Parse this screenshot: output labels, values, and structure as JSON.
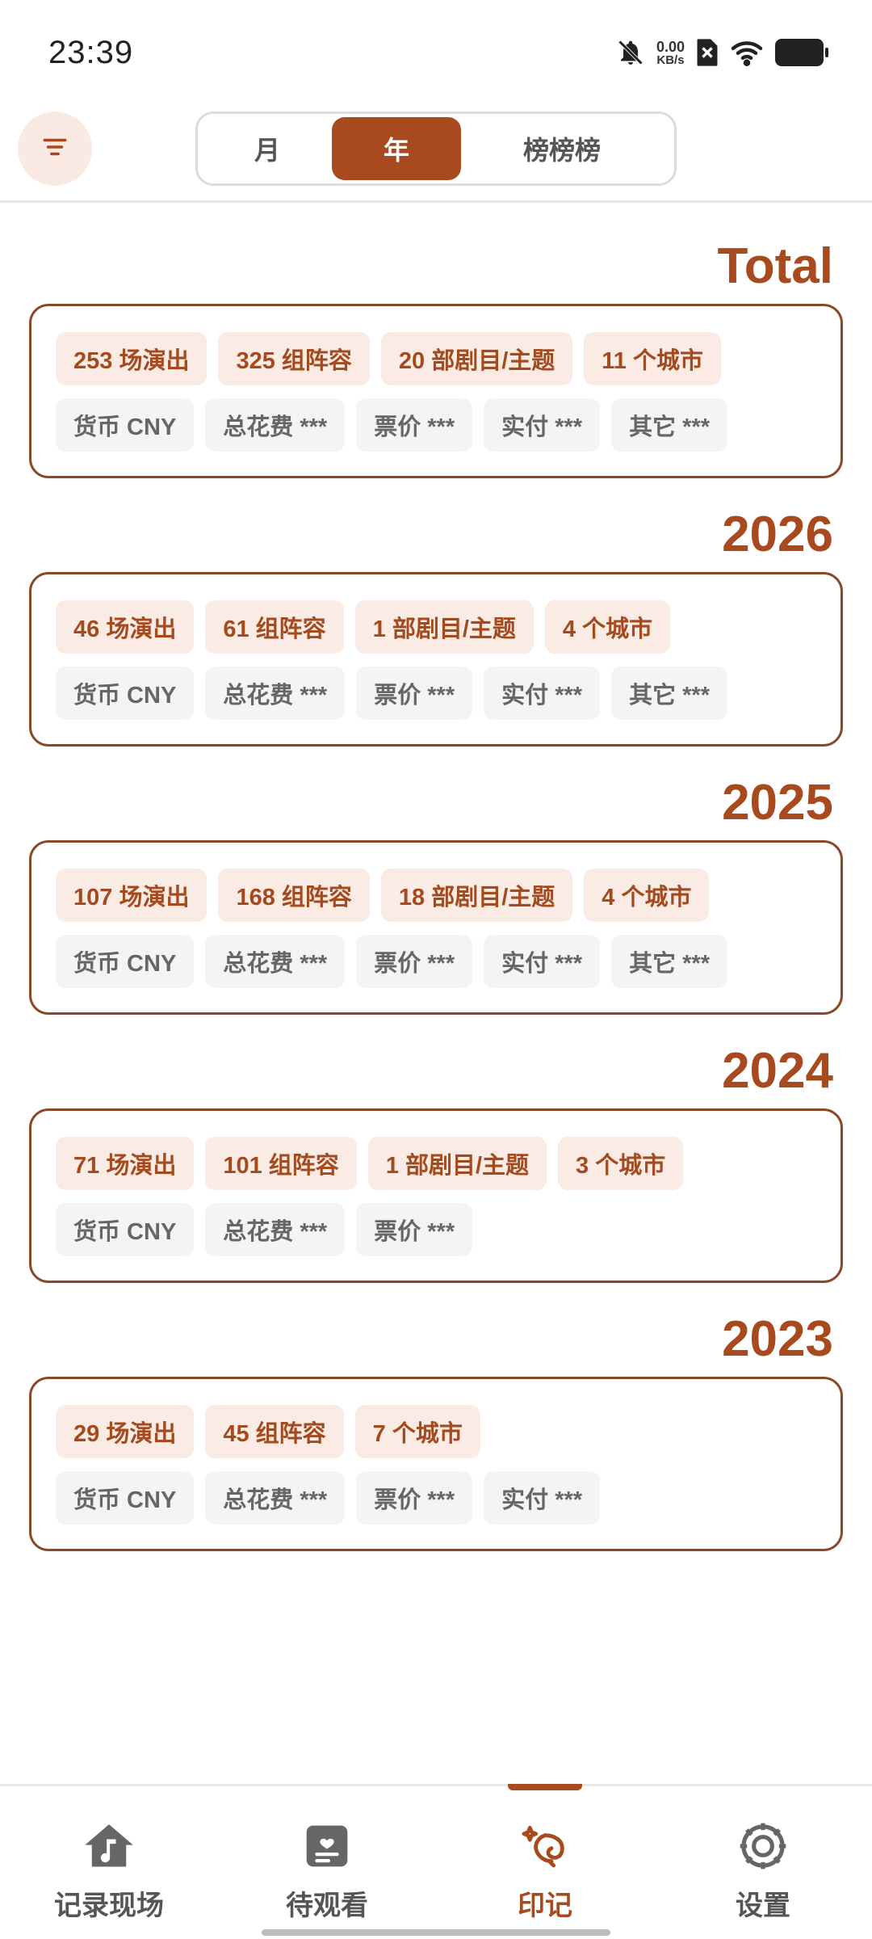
{
  "status_bar": {
    "time": "23:39",
    "net_speed_value": "0.00",
    "net_speed_unit": "KB/s",
    "icons": [
      "bell-off-icon",
      "sim-x-icon",
      "wifi-icon",
      "battery-icon"
    ]
  },
  "header": {
    "filter_icon": "filter-icon",
    "tabs": [
      {
        "label": "月",
        "active": false
      },
      {
        "label": "年",
        "active": true
      },
      {
        "label": "榜榜榜",
        "active": false
      }
    ]
  },
  "sections": [
    {
      "title": "Total",
      "stats": [
        "253 场演出",
        "325 组阵容",
        "20 部剧目/主题",
        "11 个城市"
      ],
      "costs": [
        "货币 CNY",
        "总花费 ***",
        "票价 ***",
        "实付 ***",
        "其它 ***"
      ]
    },
    {
      "title": "2026",
      "stats": [
        "46 场演出",
        "61 组阵容",
        "1 部剧目/主题",
        "4 个城市"
      ],
      "costs": [
        "货币 CNY",
        "总花费 ***",
        "票价 ***",
        "实付 ***",
        "其它 ***"
      ]
    },
    {
      "title": "2025",
      "stats": [
        "107 场演出",
        "168 组阵容",
        "18 部剧目/主题",
        "4 个城市"
      ],
      "costs": [
        "货币 CNY",
        "总花费 ***",
        "票价 ***",
        "实付 ***",
        "其它 ***"
      ]
    },
    {
      "title": "2024",
      "stats": [
        "71 场演出",
        "101 组阵容",
        "1 部剧目/主题",
        "3 个城市"
      ],
      "costs": [
        "货币 CNY",
        "总花费 ***",
        "票价 ***"
      ]
    },
    {
      "title": "2023",
      "stats": [
        "29 场演出",
        "45 组阵容",
        "7 个城市"
      ],
      "costs": [
        "货币 CNY",
        "总花费 ***",
        "票价 ***",
        "实付 ***"
      ]
    }
  ],
  "bottom_nav": [
    {
      "label": "记录现场",
      "icon": "house-music-icon",
      "active": false
    },
    {
      "label": "待观看",
      "icon": "ticket-list-icon",
      "active": false
    },
    {
      "label": "印记",
      "icon": "sparkle-mark-icon",
      "active": true
    },
    {
      "label": "设置",
      "icon": "gear-icon",
      "active": false
    }
  ],
  "colors": {
    "accent": "#a84a1d",
    "chip_accent_bg": "#fbebe5",
    "chip_muted_bg": "#f4f4f6",
    "card_border": "#8a4a2a"
  }
}
